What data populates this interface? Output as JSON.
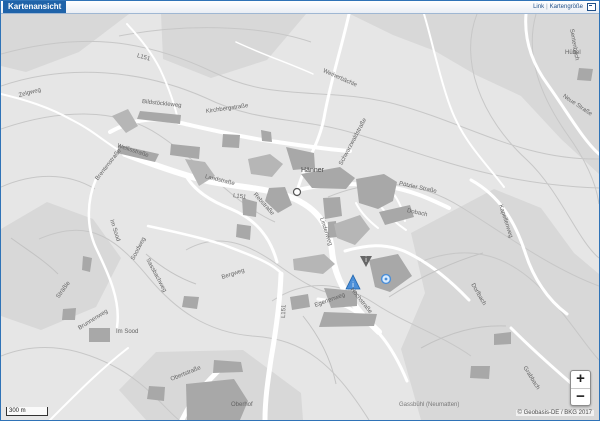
{
  "window": {
    "title": "Kartenansicht",
    "link_label": "Link",
    "separator": "|",
    "size_label": "Kartengröße"
  },
  "map": {
    "zoom_in_label": "+",
    "zoom_out_label": "−",
    "scale_label": "300 m",
    "copyright": "© Geobasis-DE / BKG 2017",
    "labels": {
      "haenner": "Hänner",
      "huebel": "Hübel",
      "im_sood": "Im Sood",
      "obernhof": "Oberhof",
      "gassbuehl": "Gassbühl (Neumatten)",
      "bildstoeckleweg": "Bildstöckleweg",
      "kirchbergstrasse": "Kirchbergstraße",
      "wellisstrasse": "Wellisstraße",
      "brentenstrasse": "Brentenstraße",
      "landstrasse": "Landstraße",
      "l151_a": "L151",
      "l151_b": "L151",
      "l151_c": "L151",
      "rebstrasse": "Rebstraße",
      "weiherbaechle": "Weiherbächle",
      "zelgweg": "Zelgweg",
      "im_sood_road": "Im Sood",
      "soodweg": "Soodweg",
      "sassbachweg": "Sassbachweg",
      "bergweg": "Bergweg",
      "doebach": "Dobach",
      "potzler_strasse": "Pötzler Straße",
      "egertenweg": "Egertenweg",
      "dorfbach": "Dorfbach",
      "schwarzwaldstrasse": "Schwarzwaldstraße",
      "lindenweg": "Lindenweg",
      "hochstrasse": "Hochstraße",
      "kapellenweg": "Kapellenweg",
      "neue_strasse": "Neue Straße",
      "strassle": "Sträßle",
      "brunnenweg": "Brunnenweg",
      "obertstrasse": "Obertstraße",
      "sentenbach": "Sentenbach",
      "grabbach": "Grabbach"
    }
  },
  "colors": {
    "frame_border": "#2f73b7",
    "title_bg": "#1f63a9",
    "map_bg": "#e6e6e6",
    "road": "#ffffff",
    "building": "#a8a8a8",
    "marker": "#4a8ed8",
    "info_icon": "#666666"
  },
  "icons": {
    "info_marker": "info-icon",
    "place_marker": "place-dot-icon",
    "expand": "expand-icon"
  }
}
